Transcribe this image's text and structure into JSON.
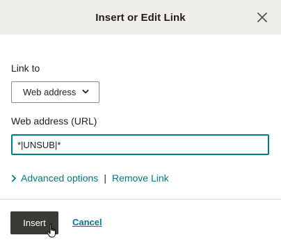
{
  "dialog": {
    "title": "Insert or Edit Link",
    "close_icon": "close-icon"
  },
  "link_to": {
    "label": "Link to",
    "selected": "Web address",
    "chevron_icon": "chevron-down-icon"
  },
  "url_field": {
    "label": "Web address (URL)",
    "value": "*|UNSUB|*"
  },
  "options": {
    "advanced_label": "Advanced options",
    "advanced_icon": "chevron-right-icon",
    "separator": "|",
    "remove_label": "Remove Link"
  },
  "footer": {
    "insert_label": "Insert",
    "cancel_label": "Cancel"
  },
  "colors": {
    "accent": "#007c89",
    "header_bg": "#efeeea",
    "primary_button": "#3b3a37"
  }
}
